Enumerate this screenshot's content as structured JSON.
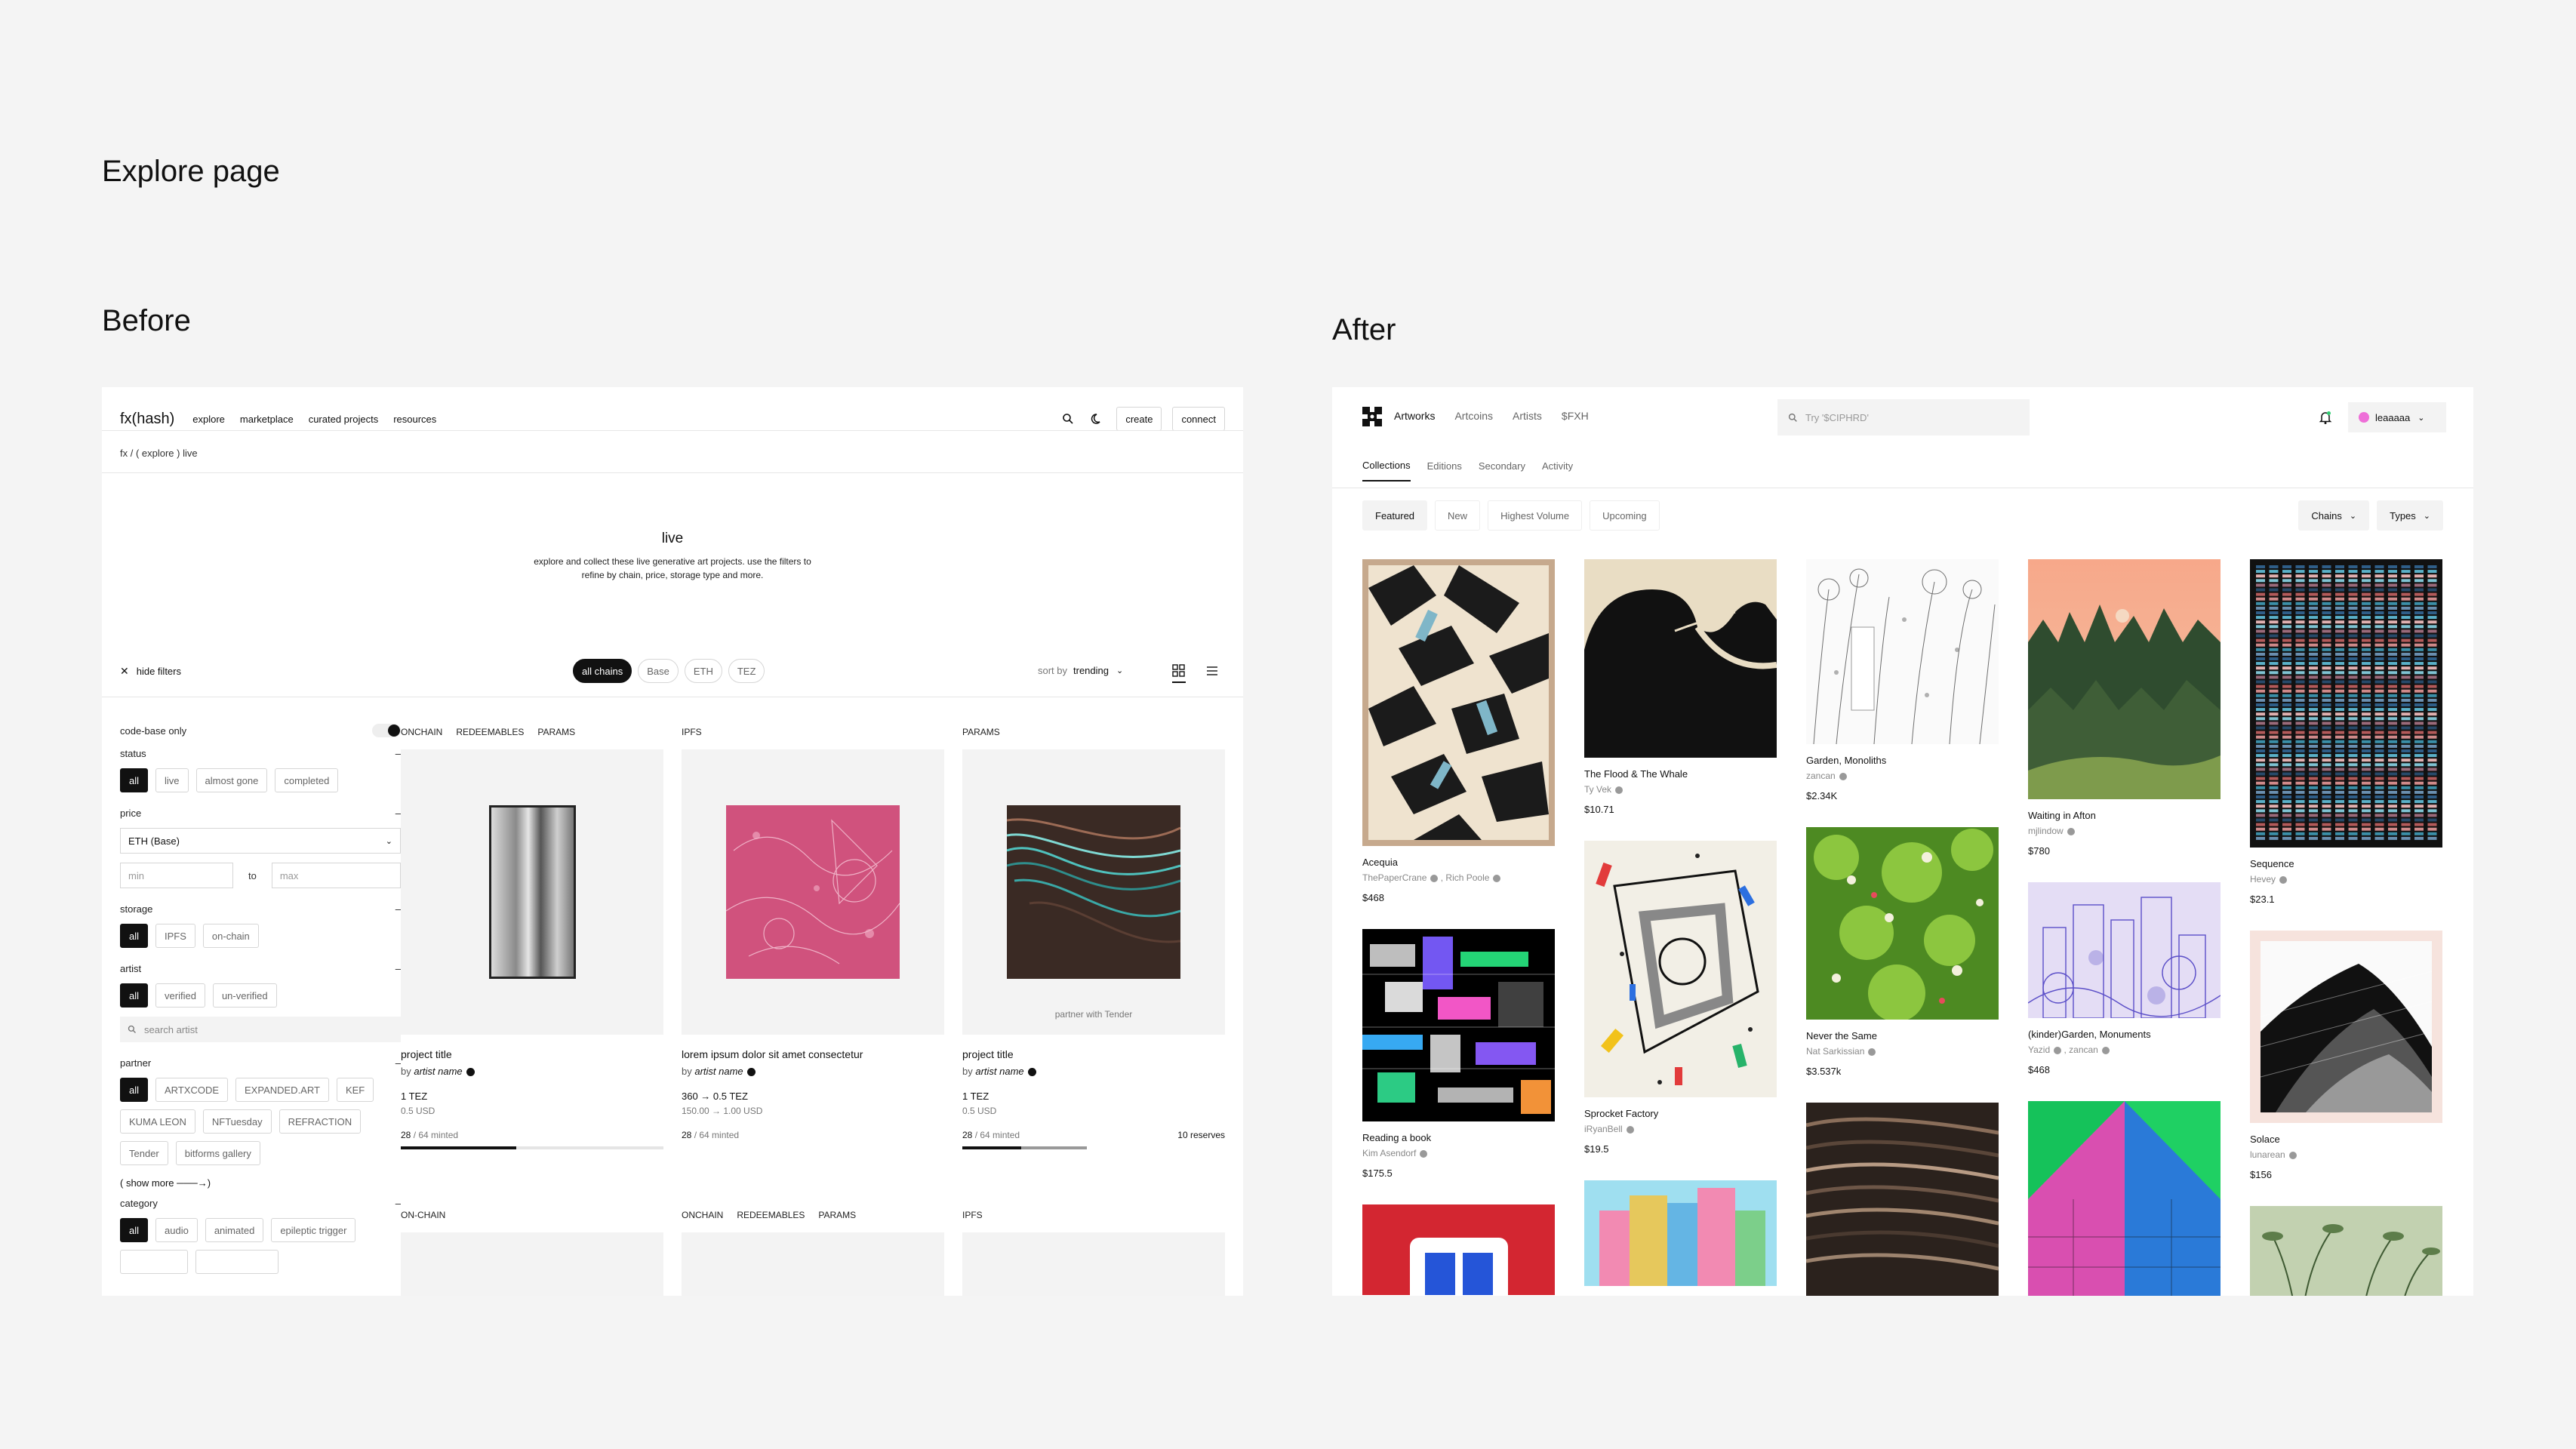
{
  "headings": {
    "page": "Explore page",
    "before": "Before",
    "after": "After"
  },
  "before": {
    "logo": "fx(hash)",
    "nav": [
      "explore",
      "marketplace",
      "curated projects",
      "resources"
    ],
    "create": "create",
    "connect": "connect",
    "breadcrumb": "fx / ( explore ) live",
    "hero": {
      "title": "live",
      "desc1": "explore and collect these live generative art projects. use the filters to",
      "desc2": "refine by chain, price, storage type and more."
    },
    "hide_filters": "hide filters",
    "chains": [
      "all chains",
      "Base",
      "ETH",
      "TEZ"
    ],
    "sort_label": "sort by",
    "sort_value": "trending",
    "filters": {
      "code_base": "code-base only",
      "status": {
        "label": "status",
        "options": [
          "all",
          "live",
          "almost gone",
          "completed"
        ]
      },
      "price": {
        "label": "price",
        "select": "ETH (Base)",
        "min": "min",
        "to": "to",
        "max": "max"
      },
      "storage": {
        "label": "storage",
        "options": [
          "all",
          "IPFS",
          "on-chain"
        ]
      },
      "artist": {
        "label": "artist",
        "options": [
          "all",
          "verified",
          "un-verified"
        ],
        "search": "search artist"
      },
      "partner": {
        "label": "partner",
        "options": [
          "all",
          "ARTXCODE",
          "EXPANDED.ART",
          "KEF",
          "KUMA LEON",
          "NFTuesday",
          "REFRACTION",
          "Tender",
          "bitforms gallery"
        ],
        "more": "( show more ───→)"
      },
      "category": {
        "label": "category",
        "options": [
          "all",
          "audio",
          "animated",
          "epileptic trigger"
        ]
      }
    },
    "cards": [
      {
        "tags": [
          "ONCHAIN",
          "REDEEMABLES",
          "PARAMS"
        ],
        "title": "project title",
        "by": "by",
        "artist": "artist name",
        "price": "1 TEZ",
        "usd": "0.5 USD",
        "minted": "28",
        "total": "/ 64 minted",
        "progress": 0.44,
        "reserves": "",
        "partner": ""
      },
      {
        "tags": [
          "IPFS"
        ],
        "title": "lorem ipsum dolor sit amet consectetur",
        "by": "by",
        "artist": "artist name",
        "price": "360 → 0.5 TEZ",
        "usd": "150.00 → 1.00 USD",
        "minted": "28",
        "total": "/ 64 minted",
        "progress": 0.0,
        "reserves": "",
        "partner": ""
      },
      {
        "tags": [
          "PARAMS"
        ],
        "title": "project title",
        "by": "by",
        "artist": "artist name",
        "price": "1 TEZ",
        "usd": "0.5 USD",
        "minted": "28",
        "total": "/ 64 minted",
        "progress": 0.47,
        "reserves": "10 reserves",
        "partner": "partner with Tender"
      }
    ],
    "row2_tags": [
      [
        "ON-CHAIN"
      ],
      [
        "ONCHAIN",
        "REDEEMABLES",
        "PARAMS"
      ],
      [
        "IPFS"
      ]
    ]
  },
  "after": {
    "nav": [
      "Artworks",
      "Artcoins",
      "Artists",
      "$FXH"
    ],
    "search_placeholder": "Try '$CIPHRD'",
    "user": "leaaaaa",
    "tabs": [
      "Collections",
      "Editions",
      "Secondary",
      "Activity"
    ],
    "filters": [
      "Featured",
      "New",
      "Highest Volume",
      "Upcoming"
    ],
    "dropdowns": [
      "Chains",
      "Types"
    ],
    "columns": [
      [
        {
          "title": "Acequia",
          "artists": [
            "ThePaperCrane",
            "Rich Poole"
          ],
          "price": "$468"
        },
        {
          "title": "Reading a book",
          "artists": [
            "Kim Asendorf"
          ],
          "price": "$175.5"
        }
      ],
      [
        {
          "title": "The Flood & The Whale",
          "artists": [
            "Ty Vek"
          ],
          "price": "$10.71"
        },
        {
          "title": "Sprocket Factory",
          "artists": [
            "iRyanBell"
          ],
          "price": "$19.5"
        }
      ],
      [
        {
          "title": "Garden, Monoliths",
          "artists": [
            "zancan"
          ],
          "price": "$2.34K"
        },
        {
          "title": "Never the Same",
          "artists": [
            "Nat Sarkissian"
          ],
          "price": "$3.537k"
        }
      ],
      [
        {
          "title": "Waiting in Afton",
          "artists": [
            "mjlindow"
          ],
          "price": "$780"
        },
        {
          "title": "(kinder)Garden, Monuments",
          "artists": [
            "Yazid",
            "zancan"
          ],
          "price": "$468"
        }
      ],
      [
        {
          "title": "Sequence",
          "artists": [
            "Hevey"
          ],
          "price": "$23.1"
        },
        {
          "title": "Solace",
          "artists": [
            "lunarean"
          ],
          "price": "$156"
        }
      ]
    ]
  }
}
